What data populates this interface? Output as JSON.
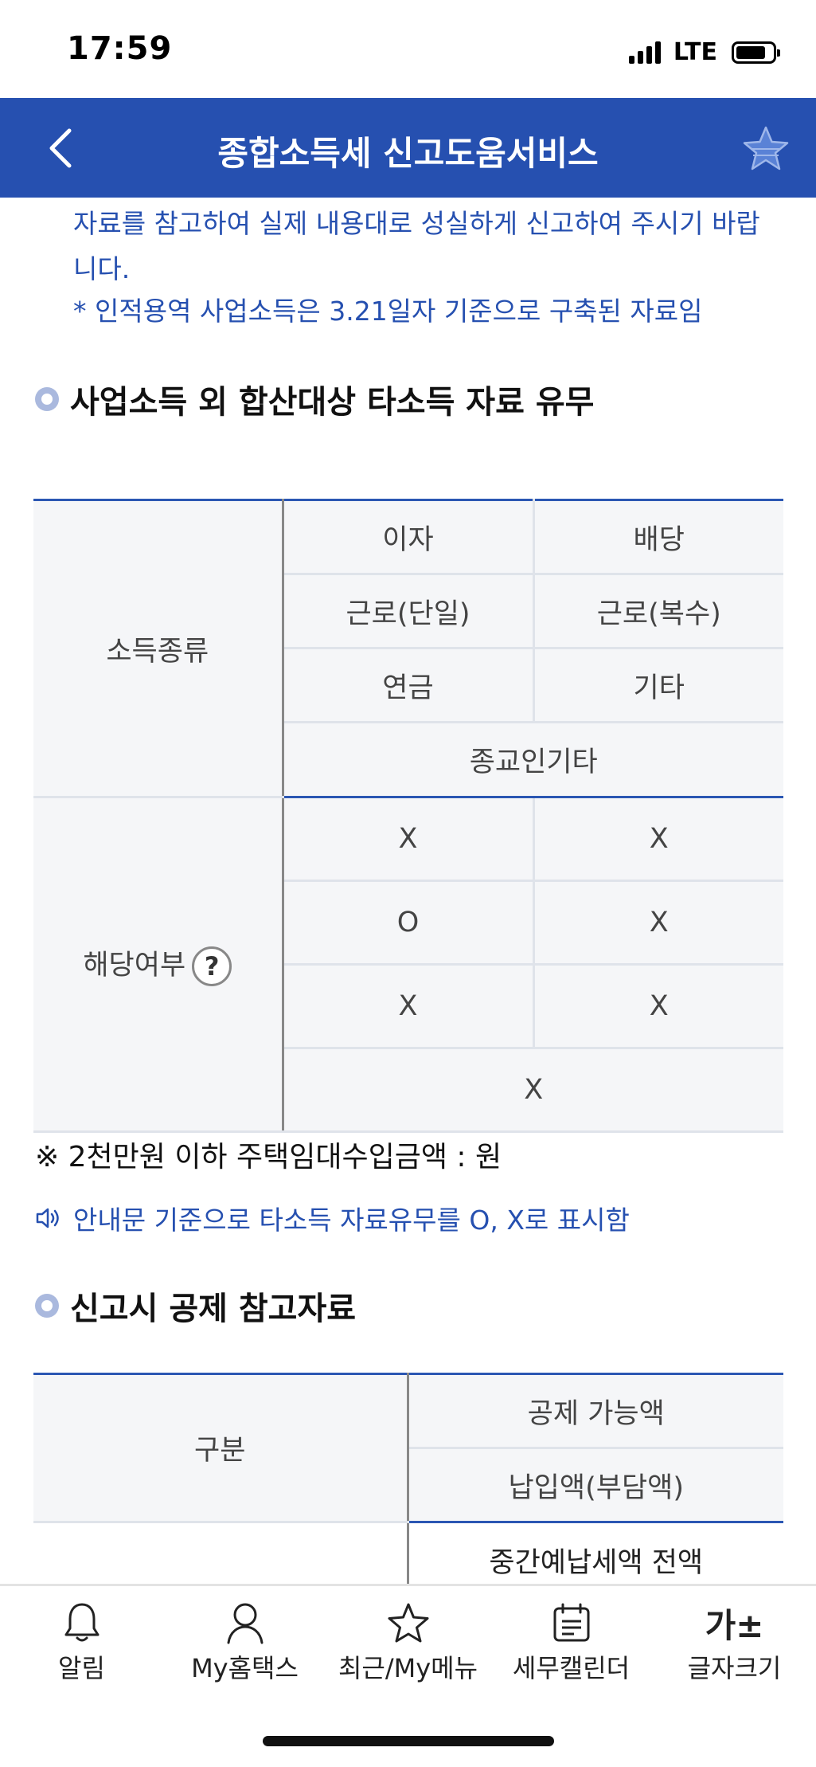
{
  "status_bar": {
    "time": "17:59",
    "network": "LTE"
  },
  "header": {
    "title": "종합소득세 신고도움서비스"
  },
  "notice": {
    "text": "자료를 참고하여 실제 내용대로 성실하게 신고하여 주시기 바랍니다.",
    "note": "* 인적용역 사업소득은 3.21일자 기준으로 구축된 자료임"
  },
  "section1": {
    "title": "사업소득 외 합산대상 타소득 자료 유무",
    "row_label_types": "소득종류",
    "row_label_status": "해당여부",
    "income_types": {
      "interest": "이자",
      "dividend": "배당",
      "labor_single": "근로(단일)",
      "labor_multi": "근로(복수)",
      "pension": "연금",
      "other": "기타",
      "religious": "종교인기타"
    },
    "status_values": {
      "interest": "X",
      "dividend": "X",
      "labor_single": "O",
      "labor_multi": "X",
      "pension": "X",
      "other": "X",
      "religious": "X"
    },
    "help_icon": "?",
    "footnote": "※ 2천만원 이하 주택임대수입금액 : 원",
    "info": "안내문 기준으로 타소득 자료유무를 O, X로 표시함"
  },
  "section2": {
    "title": "신고시 공제 참고자료",
    "col_category": "구분",
    "col_deductible": "공제 가능액",
    "col_paid": "납입액(부담액)",
    "row1_value": "중간예납세액 전액"
  },
  "tabbar": {
    "items": [
      {
        "label": "알림",
        "icon": "bell-icon"
      },
      {
        "label": "My홈택스",
        "icon": "user-icon"
      },
      {
        "label": "최근/My메뉴",
        "icon": "star-icon"
      },
      {
        "label": "세무캘린더",
        "icon": "calendar-icon"
      },
      {
        "label": "글자크기",
        "icon": "font-size-icon",
        "glyph": "가±"
      }
    ]
  },
  "colors": {
    "brand": "#2650b0",
    "accent_border": "#2b57b3",
    "table_bg": "#f5f6f8"
  }
}
